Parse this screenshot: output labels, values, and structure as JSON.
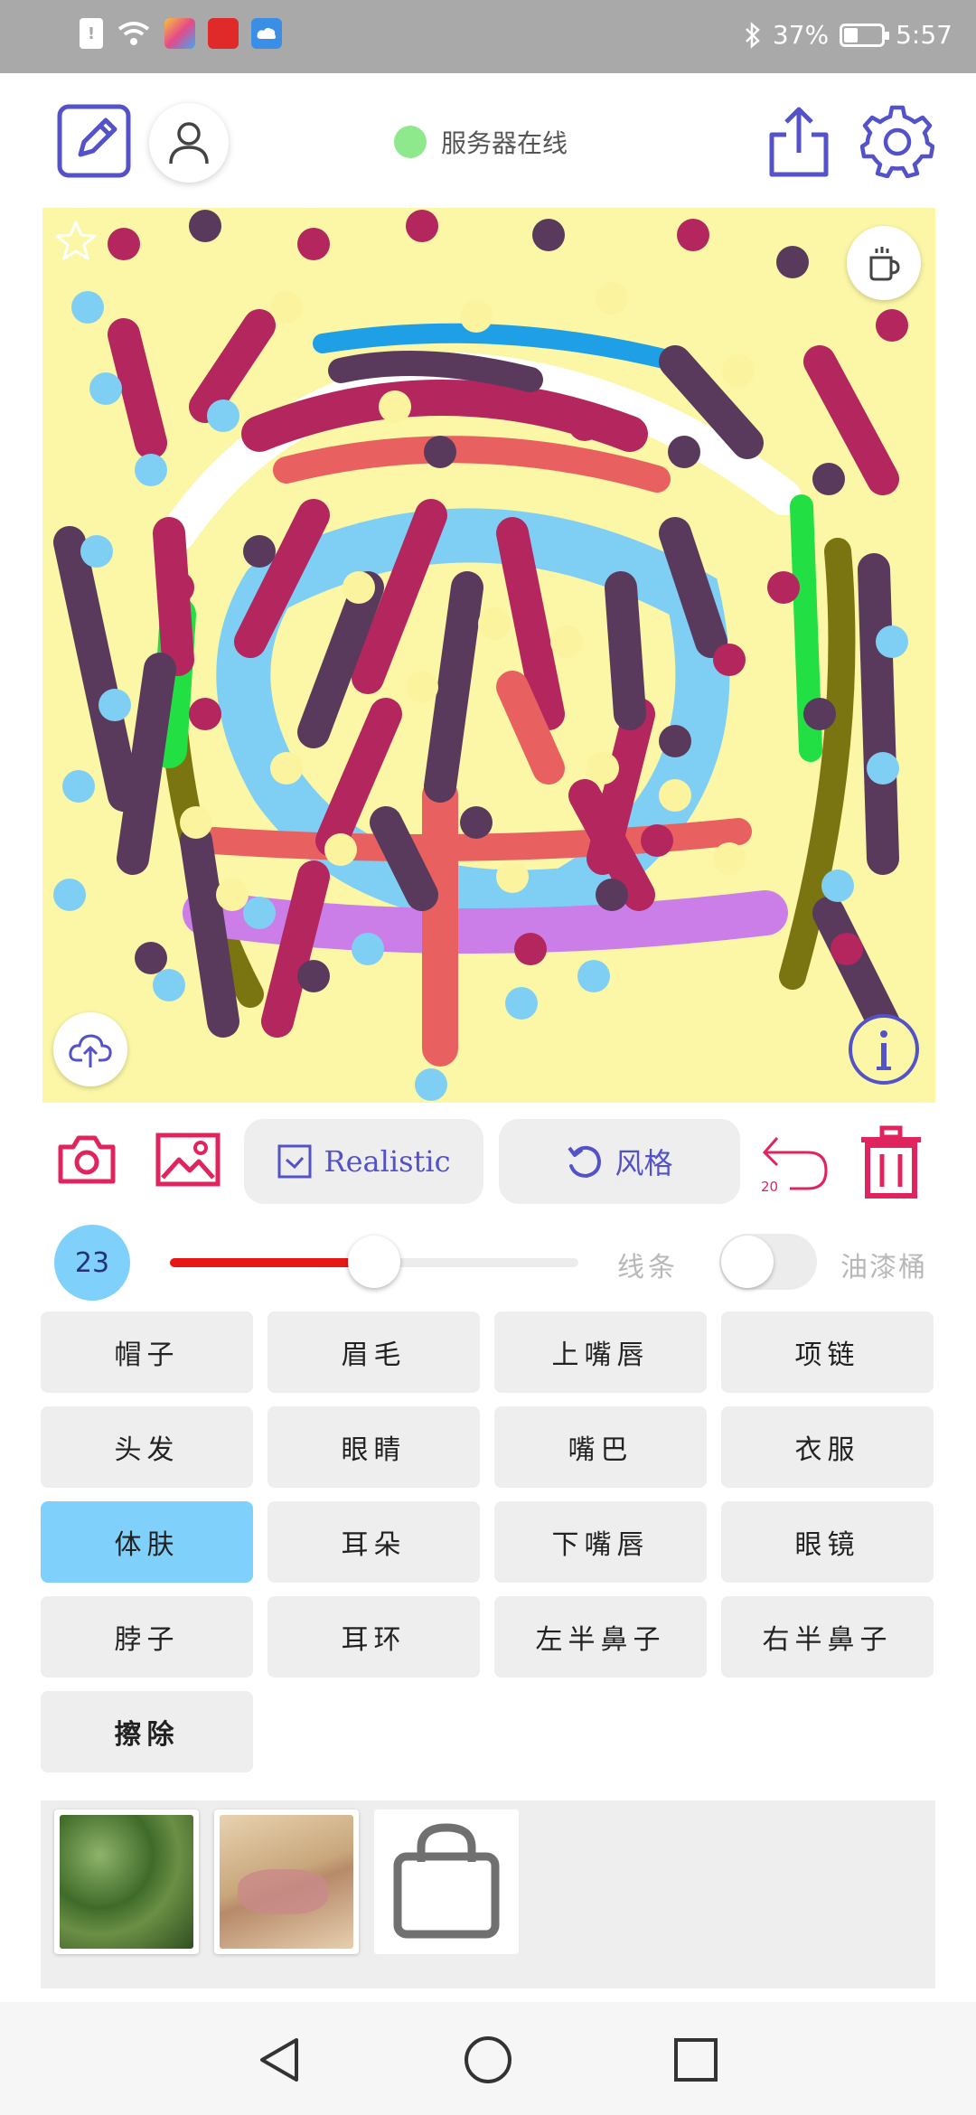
{
  "status_bar": {
    "battery_text": "37%",
    "battery_level": 0.37,
    "time": "5:57",
    "icons": [
      "alert-icon",
      "wifi-icon",
      "app-icon",
      "huawei-icon",
      "cloud-icon",
      "bluetooth-icon",
      "battery-icon"
    ]
  },
  "topbar": {
    "server_status": "服务器在线",
    "server_status_color": "#8ee88c",
    "icons": [
      "edit-icon",
      "user-icon",
      "share-icon",
      "gear-icon"
    ]
  },
  "canvas": {
    "icons": [
      "star-icon",
      "coffee-icon",
      "upload-cloud-icon",
      "info-icon"
    ]
  },
  "toolbar": {
    "style_mode_label": "Realistic",
    "style_button_label": "风格",
    "undo_count": "20",
    "accent_color": "#e0245e",
    "icons": [
      "camera-icon",
      "image-icon",
      "checkbox-icon",
      "refresh-icon",
      "undo-icon",
      "trash-icon"
    ]
  },
  "brush": {
    "size": "23",
    "slider_value": 0.5,
    "mode_line": "线条",
    "mode_fill": "油漆桶",
    "fill_enabled": false
  },
  "parts": [
    {
      "label": "帽子"
    },
    {
      "label": "眉毛"
    },
    {
      "label": "上嘴唇"
    },
    {
      "label": "项链"
    },
    {
      "label": "头发"
    },
    {
      "label": "眼睛"
    },
    {
      "label": "嘴巴"
    },
    {
      "label": "衣服"
    },
    {
      "label": "体肤",
      "selected": true
    },
    {
      "label": "耳朵"
    },
    {
      "label": "下嘴唇"
    },
    {
      "label": "眼镜"
    },
    {
      "label": "脖子"
    },
    {
      "label": "耳环"
    },
    {
      "label": "左半鼻子"
    },
    {
      "label": "右半鼻子"
    },
    {
      "label": "擦除"
    }
  ],
  "gallery": {
    "items": [
      "green-foliage-photo",
      "beige-pink-photo"
    ],
    "icons": [
      "shopping-bag-icon"
    ]
  },
  "navbar": {
    "icons": [
      "back-icon",
      "home-icon",
      "recents-icon"
    ]
  }
}
